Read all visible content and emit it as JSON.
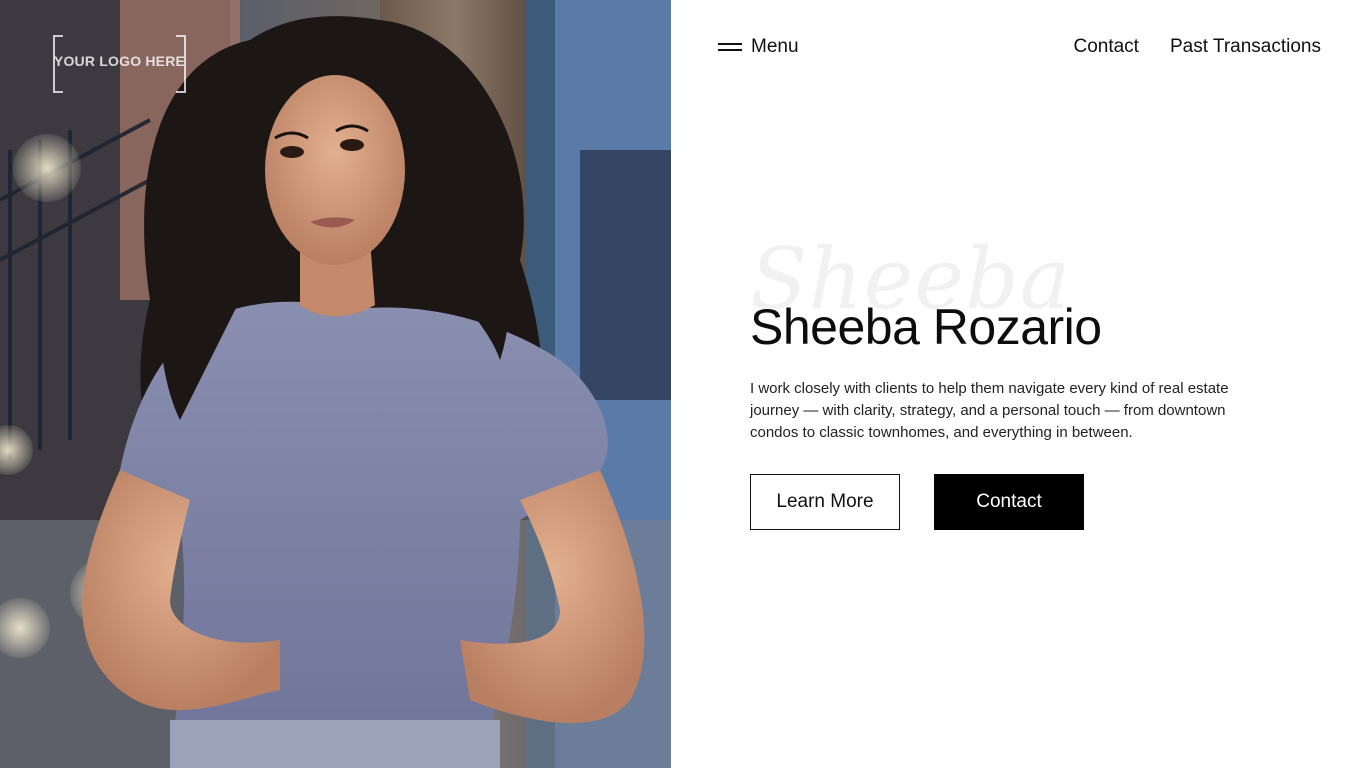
{
  "logo": {
    "text": "YOUR LOGO HERE"
  },
  "nav": {
    "menu_label": "Menu",
    "links": [
      {
        "label": "Contact"
      },
      {
        "label": "Past Transactions"
      }
    ]
  },
  "hero": {
    "script_text": "Sheeba",
    "title": "Sheeba Rozario",
    "description": "I work closely with clients to help them navigate every kind of real estate journey — with clarity, strategy, and a personal touch — from downtown condos to classic townhomes, and everything in between.",
    "buttons": {
      "learn_more": "Learn More",
      "contact": "Contact"
    }
  },
  "colors": {
    "text": "#111111",
    "background": "#ffffff",
    "button_solid": "#000000",
    "script_watermark": "#f1f1f1"
  }
}
